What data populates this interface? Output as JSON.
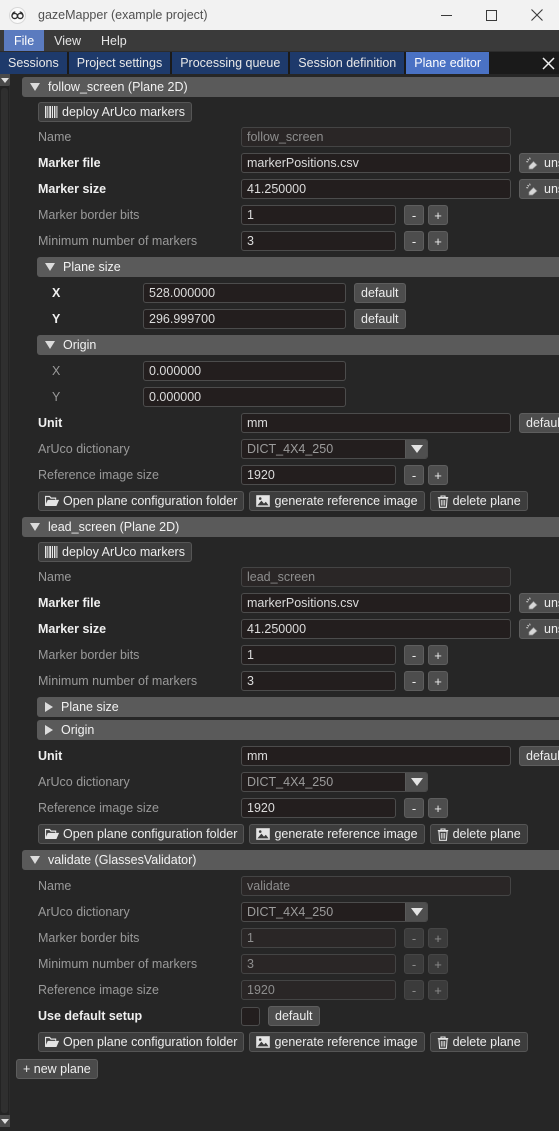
{
  "window": {
    "title": "gazeMapper (example project)",
    "icon": "glasses-icon",
    "minimize": "minimize-icon",
    "maximize": "maximize-icon",
    "close": "close-icon"
  },
  "menubar": {
    "items": [
      {
        "label": "File",
        "active": true
      },
      {
        "label": "View",
        "active": false
      },
      {
        "label": "Help",
        "active": false
      }
    ]
  },
  "tabs": {
    "items": [
      {
        "label": "Sessions",
        "active": false
      },
      {
        "label": "Project settings",
        "active": false
      },
      {
        "label": "Processing queue",
        "active": false
      },
      {
        "label": "Session definition",
        "active": false
      },
      {
        "label": "Plane editor",
        "active": true
      }
    ],
    "close_label": "close-tab"
  },
  "labels": {
    "name": "Name",
    "marker_file": "Marker file",
    "marker_size": "Marker size",
    "marker_border_bits": "Marker border bits",
    "min_markers": "Minimum number of markers",
    "plane_size": "Plane size",
    "origin": "Origin",
    "x": "X",
    "y": "Y",
    "unit": "Unit",
    "aruco_dictionary": "ArUco dictionary",
    "reference_image_size": "Reference image size",
    "use_default_setup": "Use default setup"
  },
  "buttons": {
    "deploy": "deploy ArUco markers",
    "unset": "unset",
    "default": "default",
    "minus": "-",
    "plus": "+",
    "open_folder": "Open plane configuration folder",
    "generate_reference": "generate reference image",
    "delete_plane": "delete plane",
    "new_plane": "+ new plane"
  },
  "icons": {
    "deploy": "barcode-icon",
    "unset": "eraser-icon",
    "open_folder": "folder-open-icon",
    "generate_reference": "image-icon",
    "delete_plane": "trash-icon",
    "combo_arrow": "chevron-down-icon"
  },
  "planes": [
    {
      "header": "follow_screen (Plane 2D)",
      "expanded": true,
      "name": "follow_screen",
      "marker_file": "markerPositions.csv",
      "marker_size": "41.250000",
      "marker_border_bits": "1",
      "min_markers": "3",
      "plane_size_expanded": true,
      "plane_size_x": "528.000000",
      "plane_size_y": "296.999700",
      "origin_expanded": true,
      "origin_x": "0.000000",
      "origin_y": "0.000000",
      "unit": "mm",
      "aruco_dictionary": "DICT_4X4_250",
      "reference_image_size": "1920"
    },
    {
      "header": "lead_screen (Plane 2D)",
      "expanded": true,
      "name": "lead_screen",
      "marker_file": "markerPositions.csv",
      "marker_size": "41.250000",
      "marker_border_bits": "1",
      "min_markers": "3",
      "plane_size_expanded": false,
      "origin_expanded": false,
      "unit": "mm",
      "aruco_dictionary": "DICT_4X4_250",
      "reference_image_size": "1920"
    },
    {
      "header": "validate (GlassesValidator)",
      "expanded": true,
      "name": "validate",
      "aruco_dictionary": "DICT_4X4_250",
      "marker_border_bits": "1",
      "min_markers": "3",
      "reference_image_size": "1920",
      "use_default_setup_checked": false
    }
  ]
}
